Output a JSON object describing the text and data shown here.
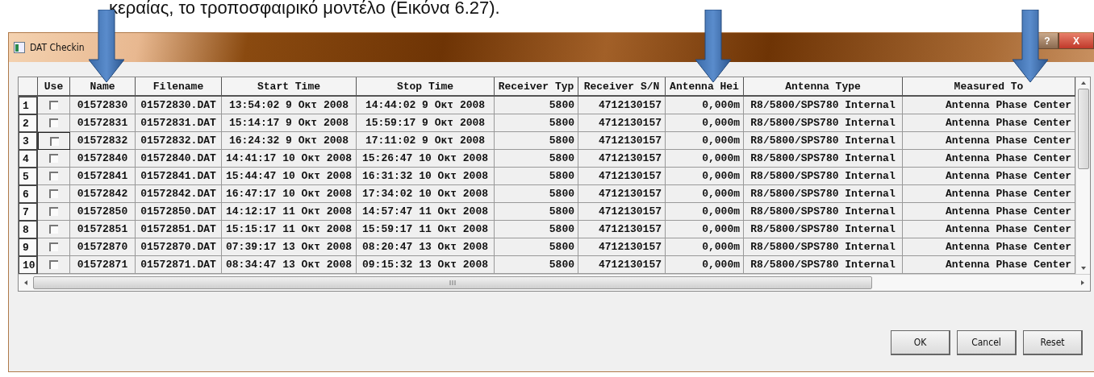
{
  "caption": "κεραίας, το τροποσφαιρικό μοντέλο (Εικόνα 6.27).",
  "window": {
    "title": "DAT Checkin",
    "help_button": "?",
    "close_button": "X"
  },
  "table": {
    "use_header": "Use",
    "columns": [
      "Name",
      "Filename",
      "Start Time",
      "Stop Time",
      "Receiver Typ",
      "Receiver S/N",
      "Antenna Hei",
      "Antenna Type",
      "Measured To"
    ],
    "rows": [
      {
        "number": "1",
        "checked": false,
        "focused": false,
        "cells": [
          "01572830",
          "01572830.DAT",
          "13:54:02 9 Οκτ 2008",
          "14:44:02 9 Οκτ 2008",
          "5800",
          "4712130157",
          "0,000m",
          "R8/5800/SPS780 Internal",
          "Antenna Phase Center"
        ]
      },
      {
        "number": "2",
        "checked": false,
        "focused": false,
        "cells": [
          "01572831",
          "01572831.DAT",
          "15:14:17 9 Οκτ 2008",
          "15:59:17 9 Οκτ 2008",
          "5800",
          "4712130157",
          "0,000m",
          "R8/5800/SPS780 Internal",
          "Antenna Phase Center"
        ]
      },
      {
        "number": "3",
        "checked": false,
        "focused": true,
        "cells": [
          "01572832",
          "01572832.DAT",
          "16:24:32 9 Οκτ 2008",
          "17:11:02 9 Οκτ 2008",
          "5800",
          "4712130157",
          "0,000m",
          "R8/5800/SPS780 Internal",
          "Antenna Phase Center"
        ]
      },
      {
        "number": "4",
        "checked": false,
        "focused": false,
        "cells": [
          "01572840",
          "01572840.DAT",
          "14:41:17 10 Οκτ 2008",
          "15:26:47 10 Οκτ 2008",
          "5800",
          "4712130157",
          "0,000m",
          "R8/5800/SPS780 Internal",
          "Antenna Phase Center"
        ]
      },
      {
        "number": "5",
        "checked": false,
        "focused": false,
        "cells": [
          "01572841",
          "01572841.DAT",
          "15:44:47 10 Οκτ 2008",
          "16:31:32 10 Οκτ 2008",
          "5800",
          "4712130157",
          "0,000m",
          "R8/5800/SPS780 Internal",
          "Antenna Phase Center"
        ]
      },
      {
        "number": "6",
        "checked": false,
        "focused": false,
        "cells": [
          "01572842",
          "01572842.DAT",
          "16:47:17 10 Οκτ 2008",
          "17:34:02 10 Οκτ 2008",
          "5800",
          "4712130157",
          "0,000m",
          "R8/5800/SPS780 Internal",
          "Antenna Phase Center"
        ]
      },
      {
        "number": "7",
        "checked": false,
        "focused": false,
        "cells": [
          "01572850",
          "01572850.DAT",
          "14:12:17 11 Οκτ 2008",
          "14:57:47 11 Οκτ 2008",
          "5800",
          "4712130157",
          "0,000m",
          "R8/5800/SPS780 Internal",
          "Antenna Phase Center"
        ]
      },
      {
        "number": "8",
        "checked": false,
        "focused": false,
        "cells": [
          "01572851",
          "01572851.DAT",
          "15:15:17 11 Οκτ 2008",
          "15:59:17 11 Οκτ 2008",
          "5800",
          "4712130157",
          "0,000m",
          "R8/5800/SPS780 Internal",
          "Antenna Phase Center"
        ]
      },
      {
        "number": "9",
        "checked": false,
        "focused": false,
        "cells": [
          "01572870",
          "01572870.DAT",
          "07:39:17 13 Οκτ 2008",
          "08:20:47 13 Οκτ 2008",
          "5800",
          "4712130157",
          "0,000m",
          "R8/5800/SPS780 Internal",
          "Antenna Phase Center"
        ]
      },
      {
        "number": "10",
        "checked": false,
        "focused": false,
        "cells": [
          "01572871",
          "01572871.DAT",
          "08:34:47 13 Οκτ 2008",
          "09:15:32 13 Οκτ 2008",
          "5800",
          "4712130157",
          "0,000m",
          "R8/5800/SPS780 Internal",
          "Antenna Phase Center"
        ]
      }
    ]
  },
  "buttons": [
    "OK",
    "Cancel",
    "Reset"
  ]
}
